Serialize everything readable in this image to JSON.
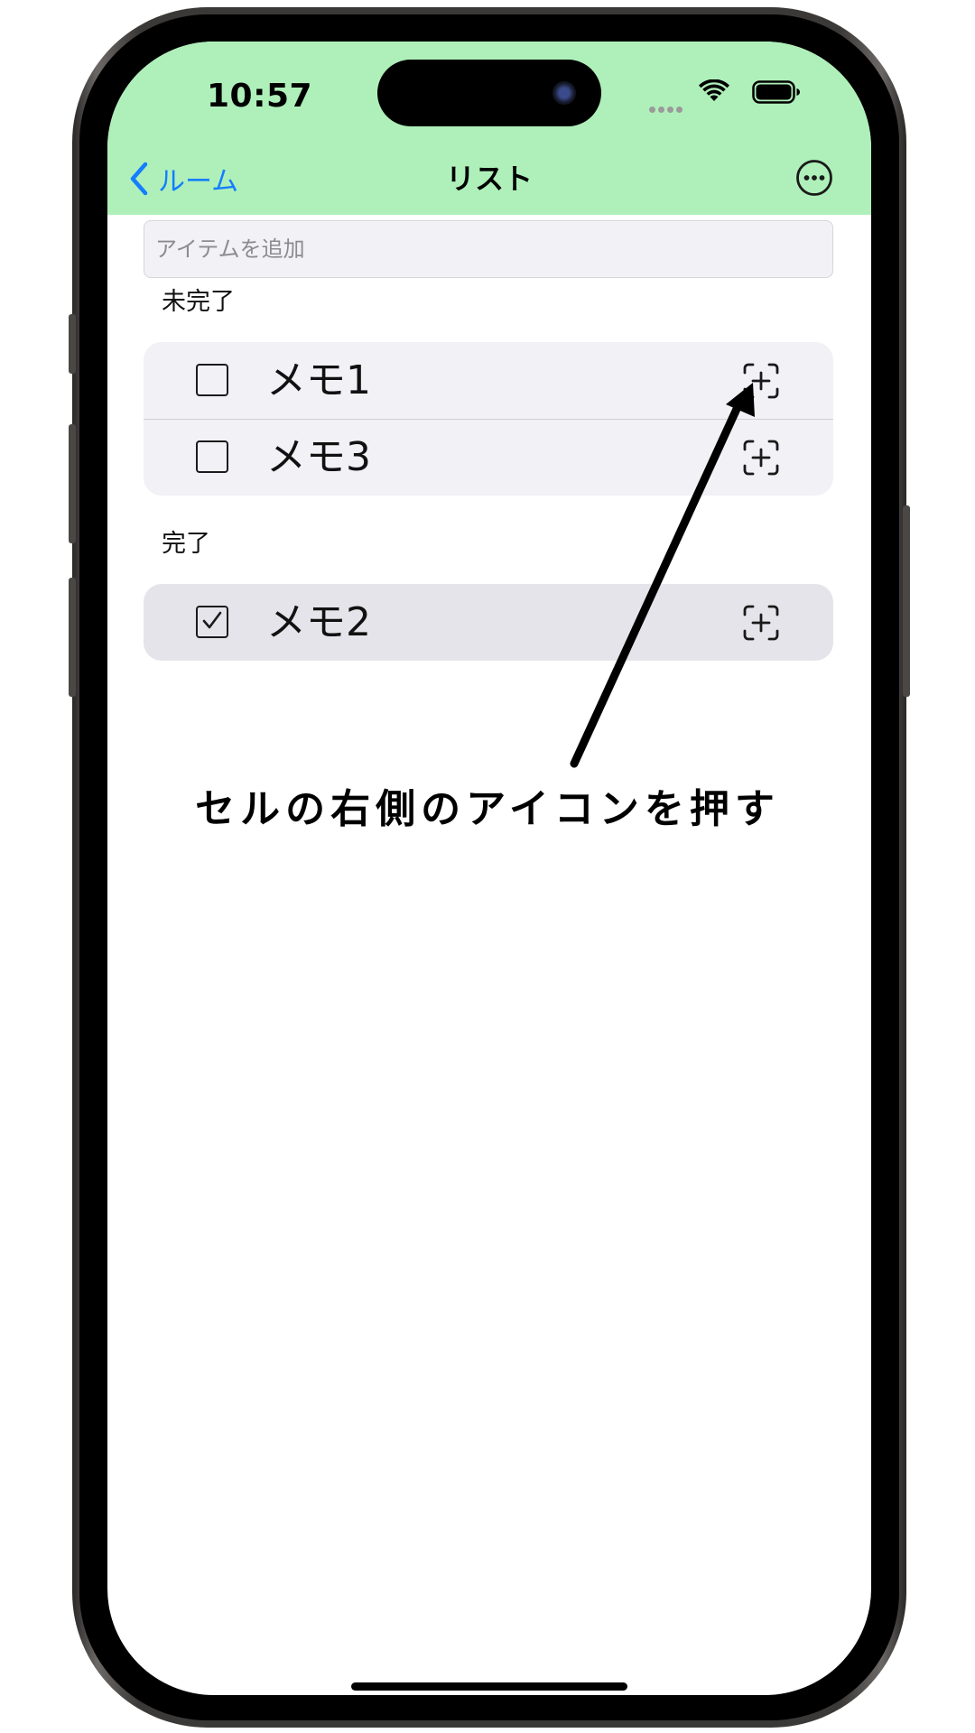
{
  "status_bar": {
    "time": "10:57"
  },
  "nav": {
    "back_label": "ルーム",
    "title": "リスト"
  },
  "add_item": {
    "placeholder": "アイテムを追加"
  },
  "sections": {
    "incomplete": {
      "header": "未完了",
      "items": [
        {
          "label": "メモ1",
          "checked": false
        },
        {
          "label": "メモ3",
          "checked": false
        }
      ]
    },
    "complete": {
      "header": "完了",
      "items": [
        {
          "label": "メモ2",
          "checked": true
        }
      ]
    }
  },
  "annotation": {
    "text": "セルの右側のアイコンを押す"
  },
  "colors": {
    "header_bg": "#aff0ba",
    "accent": "#147eff"
  },
  "icons": {
    "back": "chevron-left-icon",
    "more": "ellipsis-circle-icon",
    "row_action": "plus-viewfinder-icon"
  }
}
